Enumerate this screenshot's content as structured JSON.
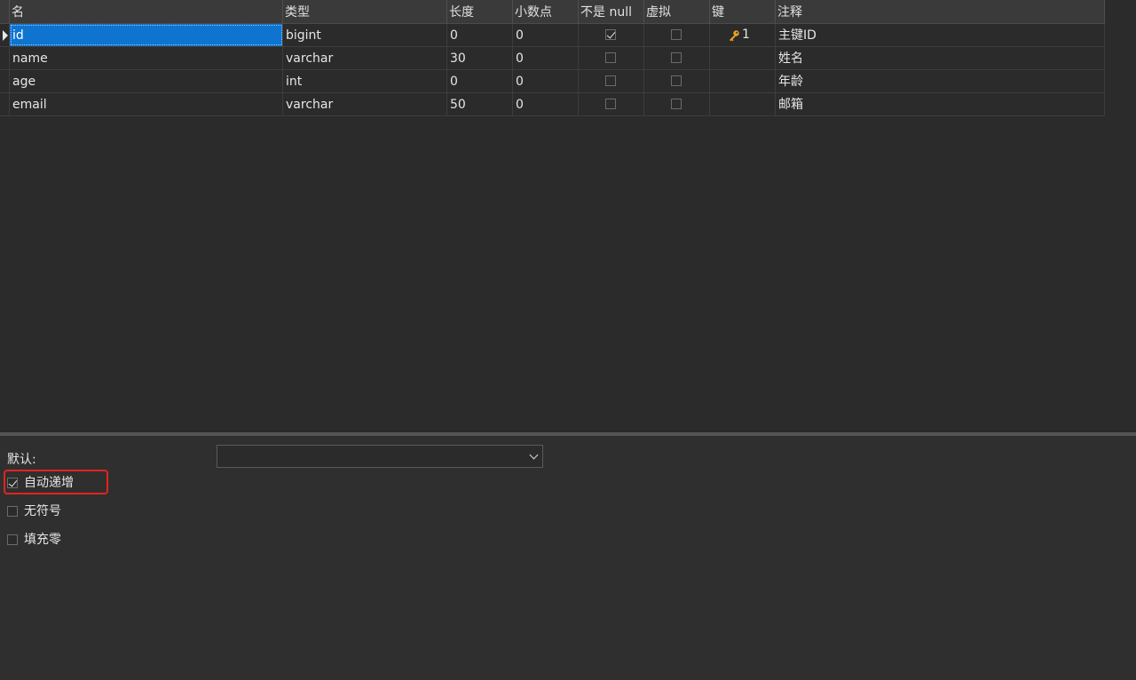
{
  "columns": [
    "名",
    "类型",
    "长度",
    "小数点",
    "不是 null",
    "虚拟",
    "键",
    "注释"
  ],
  "rows": [
    {
      "name": "id",
      "type": "bigint",
      "length": "0",
      "decimals": "0",
      "not_null": true,
      "virtual": false,
      "key": "1",
      "comment": "主键ID"
    },
    {
      "name": "name",
      "type": "varchar",
      "length": "30",
      "decimals": "0",
      "not_null": false,
      "virtual": false,
      "key": "",
      "comment": "姓名"
    },
    {
      "name": "age",
      "type": "int",
      "length": "0",
      "decimals": "0",
      "not_null": false,
      "virtual": false,
      "key": "",
      "comment": "年龄"
    },
    {
      "name": "email",
      "type": "varchar",
      "length": "50",
      "decimals": "0",
      "not_null": false,
      "virtual": false,
      "key": "",
      "comment": "邮箱"
    }
  ],
  "properties": {
    "default_label": "默认:",
    "default_value": "",
    "options": [
      {
        "label": "自动递增",
        "checked": true
      },
      {
        "label": "无符号",
        "checked": false
      },
      {
        "label": "填充零",
        "checked": false
      }
    ]
  },
  "colors": {
    "selection": "#0e74d0",
    "highlight_box": "#e3241e",
    "key_icon": "#e8a41c"
  },
  "icons": {
    "row_pointer": "triangle-right-icon",
    "key": "key-icon",
    "dropdown": "chevron-down-icon"
  }
}
